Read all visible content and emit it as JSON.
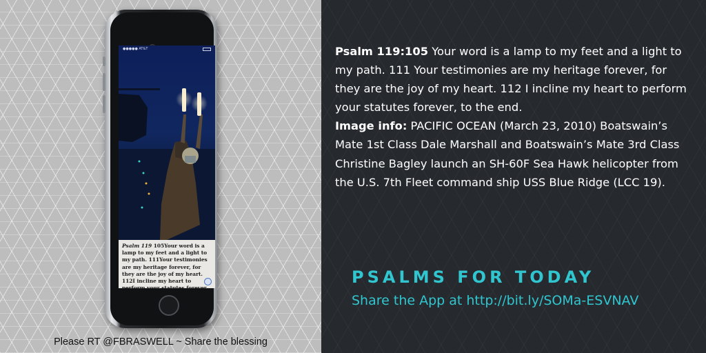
{
  "verse": {
    "reference": "Psalm 119:105",
    "text": "Your word is a lamp to my feet and a light to my path. 111 Your testimonies are my heritage forever, for they are the joy of my heart. 112 I incline my heart to perform your statutes forever, to the end."
  },
  "image_info": {
    "label": "Image info:",
    "text": "PACIFIC OCEAN (March 23, 2010) Boatswain’s Mate 1st Class Dale Marshall and Boatswain’s Mate 3rd Class Christine Bagley launch an SH-60F Sea Hawk helicopter from the U.S. 7th Fleet command ship USS Blue Ridge (LCC 19)."
  },
  "app": {
    "title": "PSALMS FOR TODAY",
    "share_prefix": "Share the App at",
    "share_url": "http://bit.ly/SOMa-ESVNAV"
  },
  "caption": "Please RT @FBRASWELL ~ Share the blessing",
  "phone_screen": {
    "status_text": "●●●●● AT&T",
    "card_ref": "Psalm 119",
    "card_text": "105Your word is a lamp to my feet and a light to my path. 111Your testimonies are my heritage forever, for they are the joy of my heart. 112I incline my heart to perform your statutes forever, to the"
  },
  "colors": {
    "accent": "#31c6cf",
    "panel_dark": "#262a2f",
    "panel_light": "#bdbdbd"
  }
}
